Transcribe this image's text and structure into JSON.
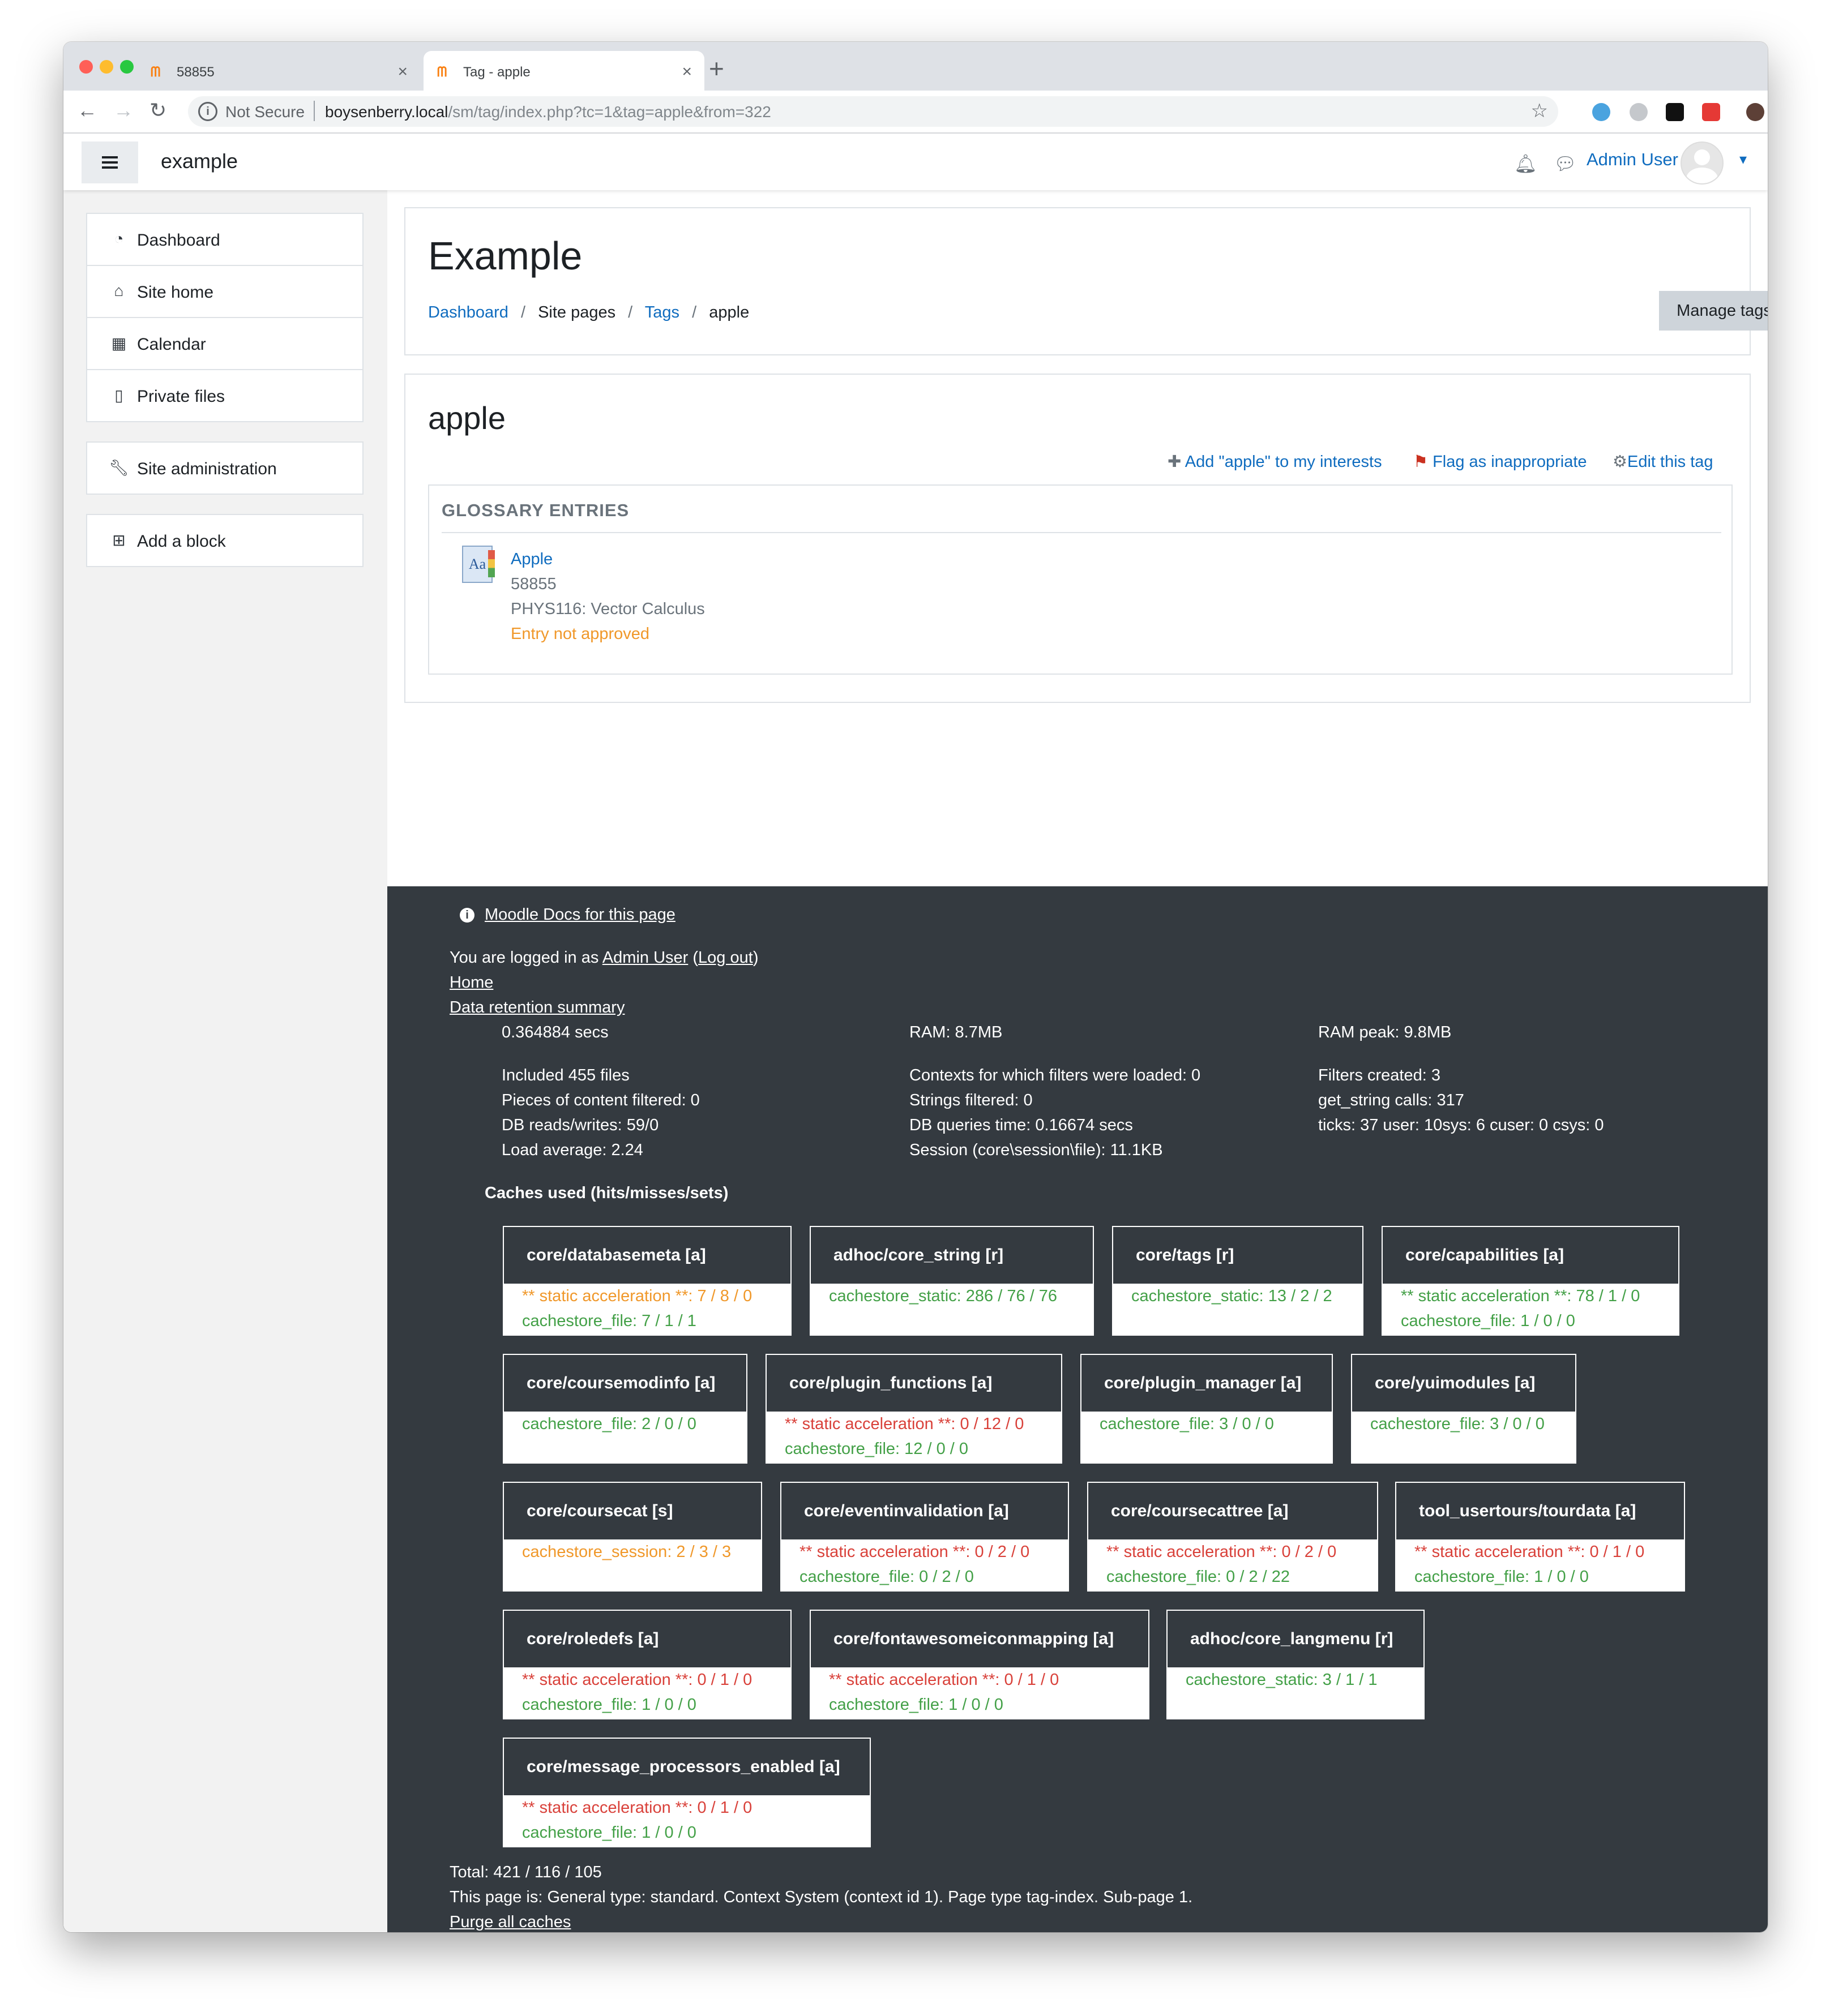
{
  "browser": {
    "tabs": [
      {
        "title": "58855",
        "active": false
      },
      {
        "title": "Tag - apple",
        "active": true
      }
    ],
    "security_label": "Not Secure",
    "url_host": "boysenberry.local",
    "url_path": "/sm/tag/index.php?tc=1&tag=apple&from=322"
  },
  "navbar": {
    "site_name": "example",
    "user_name": "Admin User"
  },
  "drawer": {
    "items": [
      {
        "label": "Dashboard",
        "icon": "dashboard-icon"
      },
      {
        "label": "Site home",
        "icon": "home-icon"
      },
      {
        "label": "Calendar",
        "icon": "calendar-icon"
      },
      {
        "label": "Private files",
        "icon": "file-icon"
      }
    ],
    "site_admin": "Site administration",
    "add_block": "Add a block"
  },
  "header": {
    "title": "Example",
    "breadcrumb": [
      "Dashboard",
      "Site pages",
      "Tags",
      "apple"
    ],
    "manage_tags": "Manage tags"
  },
  "tag": {
    "name": "apple",
    "actions": {
      "add_interest": "Add \"apple\" to my interests",
      "flag": "Flag as inappropriate",
      "edit": "Edit this tag"
    },
    "section_title": "GLOSSARY ENTRIES",
    "entry": {
      "title": "Apple",
      "id": "58855",
      "course": "PHYS116: Vector Calculus",
      "status": "Entry not approved"
    }
  },
  "footer": {
    "docs_link": "Moodle Docs for this page",
    "logged_in_prefix": "You are logged in as ",
    "logged_in_user": "Admin User",
    "logout": "Log out",
    "home": "Home",
    "data_retention": "Data retention summary",
    "perf": {
      "col1": [
        "0.364884 secs",
        "Included 455 files",
        "Pieces of content filtered: 0",
        "DB reads/writes: 59/0",
        "Load average: 2.24"
      ],
      "col2": [
        "RAM: 8.7MB",
        "Contexts for which filters were loaded: 0",
        "Strings filtered: 0",
        "DB queries time: 0.16674 secs",
        "Session (core\\session\\file): 11.1KB"
      ],
      "col3": [
        "RAM peak: 9.8MB",
        "Filters created: 3",
        "get_string calls: 317",
        "ticks: 37 user: 10sys: 6 cuser: 0 csys: 0"
      ]
    },
    "caches_title": "Caches used (hits/misses/sets)",
    "caches": [
      {
        "name": "core/databasemeta [a]",
        "lines": [
          {
            "text": "** static acceleration **: 7 / 8 / 0",
            "color": "orange"
          },
          {
            "text": "cachestore_file: 7 / 1 / 1",
            "color": "green"
          }
        ]
      },
      {
        "name": "adhoc/core_string [r]",
        "lines": [
          {
            "text": "cachestore_static: 286 / 76 / 76",
            "color": "green"
          }
        ]
      },
      {
        "name": "core/tags [r]",
        "lines": [
          {
            "text": "cachestore_static: 13 / 2 / 2",
            "color": "green"
          }
        ]
      },
      {
        "name": "core/capabilities [a]",
        "lines": [
          {
            "text": "** static acceleration **: 78 / 1 / 0",
            "color": "green"
          },
          {
            "text": "cachestore_file: 1 / 0 / 0",
            "color": "green"
          }
        ]
      },
      {
        "name": "core/coursemodinfo [a]",
        "lines": [
          {
            "text": "cachestore_file: 2 / 0 / 0",
            "color": "green"
          }
        ]
      },
      {
        "name": "core/plugin_functions [a]",
        "lines": [
          {
            "text": "** static acceleration **: 0 / 12 / 0",
            "color": "red"
          },
          {
            "text": "cachestore_file: 12 / 0 / 0",
            "color": "green"
          }
        ]
      },
      {
        "name": "core/plugin_manager [a]",
        "lines": [
          {
            "text": "cachestore_file: 3 / 0 / 0",
            "color": "green"
          }
        ]
      },
      {
        "name": "core/yuimodules [a]",
        "lines": [
          {
            "text": "cachestore_file: 3 / 0 / 0",
            "color": "green"
          }
        ]
      },
      {
        "name": "core/coursecat [s]",
        "lines": [
          {
            "text": "cachestore_session: 2 / 3 / 3",
            "color": "orange"
          }
        ]
      },
      {
        "name": "core/eventinvalidation [a]",
        "lines": [
          {
            "text": "** static acceleration **: 0 / 2 / 0",
            "color": "red"
          },
          {
            "text": "cachestore_file: 0 / 2 / 0",
            "color": "green"
          }
        ]
      },
      {
        "name": "core/coursecattree [a]",
        "lines": [
          {
            "text": "** static acceleration **: 0 / 2 / 0",
            "color": "red"
          },
          {
            "text": "cachestore_file: 0 / 2 / 22",
            "color": "green"
          }
        ]
      },
      {
        "name": "tool_usertours/tourdata [a]",
        "lines": [
          {
            "text": "** static acceleration **: 0 / 1 / 0",
            "color": "red"
          },
          {
            "text": "cachestore_file: 1 / 0 / 0",
            "color": "green"
          }
        ]
      },
      {
        "name": "core/roledefs [a]",
        "lines": [
          {
            "text": "** static acceleration **: 0 / 1 / 0",
            "color": "red"
          },
          {
            "text": "cachestore_file: 1 / 0 / 0",
            "color": "green"
          }
        ]
      },
      {
        "name": "core/fontawesomeiconmapping [a]",
        "lines": [
          {
            "text": "** static acceleration **: 0 / 1 / 0",
            "color": "red"
          },
          {
            "text": "cachestore_file: 1 / 0 / 0",
            "color": "green"
          }
        ]
      },
      {
        "name": "adhoc/core_langmenu [r]",
        "lines": [
          {
            "text": "cachestore_static: 3 / 1 / 1",
            "color": "green"
          }
        ]
      },
      {
        "name": "core/message_processors_enabled [a]",
        "lines": [
          {
            "text": "** static acceleration **: 0 / 1 / 0",
            "color": "red"
          },
          {
            "text": "cachestore_file: 1 / 0 / 0",
            "color": "green"
          }
        ]
      }
    ],
    "total": "Total: 421 / 116 / 105",
    "page_info": "This page is: General type: standard. Context System (context id 1). Page type tag-index. Sub-page 1.",
    "purge": "Purge all caches"
  },
  "colors": {
    "link": "#0f6cbf",
    "footer_bg": "#343a40",
    "green": "#43a047",
    "orange": "#f0982a",
    "red": "#d9413a"
  }
}
